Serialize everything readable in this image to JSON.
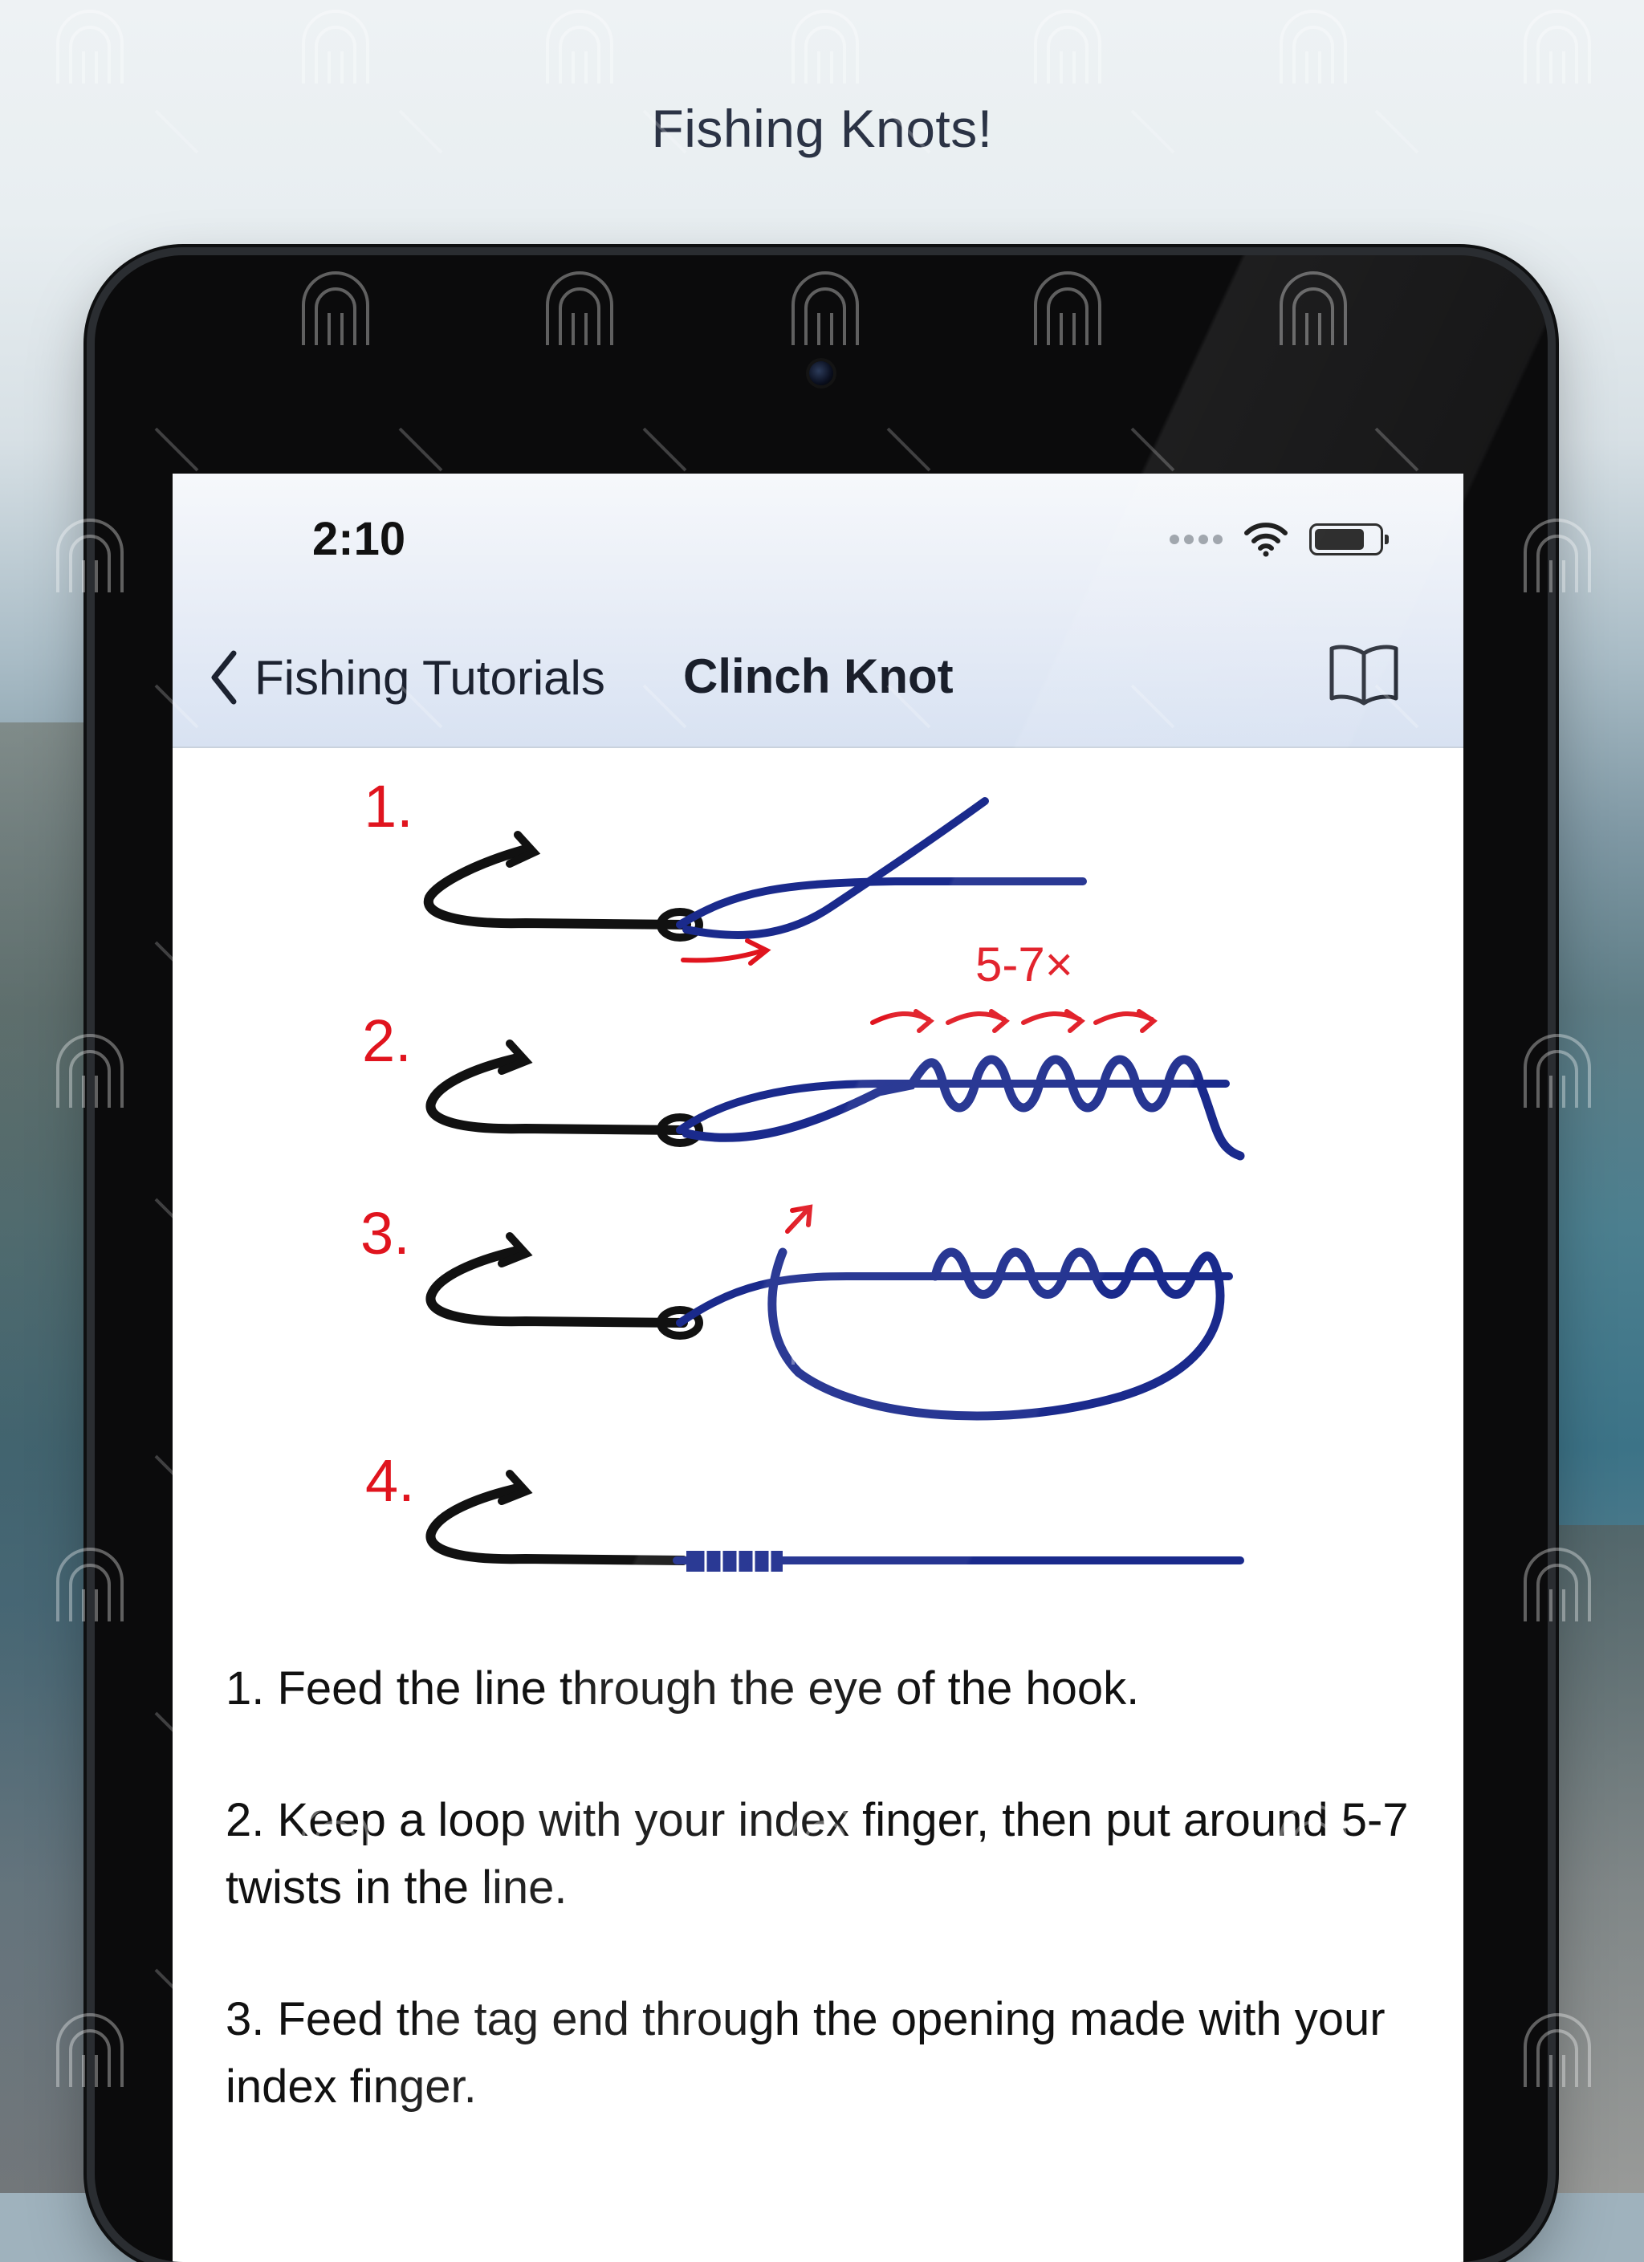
{
  "banner": {
    "title": "Fishing Knots!"
  },
  "status_bar": {
    "time": "2:10"
  },
  "nav": {
    "back_label": "Fishing Tutorials",
    "title": "Clinch Knot",
    "back_icon": "chevron-left-icon",
    "book_icon": "book-icon"
  },
  "diagram": {
    "step_labels": [
      "1.",
      "2.",
      "3.",
      "4."
    ],
    "twist_annotation": "5-7×",
    "colors": {
      "hook": "#111111",
      "line": "#1a2a8c",
      "annotation": "#e0141e"
    }
  },
  "instructions": [
    "1. Feed the line through the eye of the hook.",
    "2. Keep a loop with your index finger, then put around 5-7 twists in the line.",
    "3. Feed the tag end through the opening made with your index finger."
  ]
}
